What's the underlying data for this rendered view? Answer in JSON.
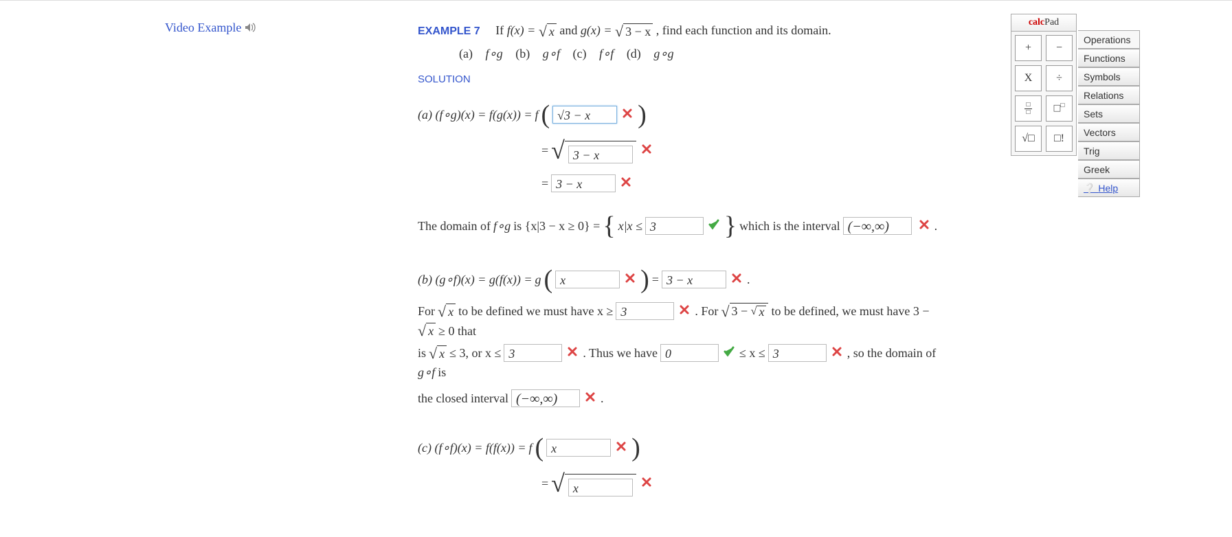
{
  "video_link": "Video Example",
  "example": {
    "label": "EXAMPLE 7",
    "prompt_a": "If ",
    "fx": "f(x) = ",
    "root_x": "x",
    "and": " and ",
    "gx": "g(x) = ",
    "root_g": "3 − x",
    "prompt_b": ", find each function and its domain."
  },
  "parts_list": {
    "a": "(a)",
    "b": "(b)",
    "c": "(c)",
    "d": "(d)",
    "fog": "f∘g",
    "gof": "g∘f",
    "fof": "f∘f",
    "gog": "g∘g"
  },
  "solution_label": "SOLUTION",
  "a": {
    "line1_pre": "(a)    (f∘g)(x) = f(g(x)) = ",
    "f": "f",
    "input1": "√3 − x",
    "eq": "=",
    "input2": "3 − x",
    "input3": "3 − x",
    "domain_pre": "The domain of ",
    "fog": "f∘g",
    "domain_mid": " is  {x|3 − x ≥ 0}  = ",
    "set_pre": "x|x ≤ ",
    "input4": "3",
    "domain_post": " which is the interval ",
    "input5": "(−∞,∞)",
    "dot": "."
  },
  "b": {
    "line1": "(b)    (g∘f)(x) = g(f(x)) = ",
    "g": "g",
    "input1": "x",
    "eq": " = ",
    "input2": "3 − x",
    "dot": ".",
    "for1": "For ",
    "rootx": "x",
    "for2": " to be defined we must have  x ≥ ",
    "input3": "3",
    "for3": " .   For ",
    "root3mx": "3 − ",
    "rootxin": "x",
    "for4": " to be defined, we must have  3 − ",
    "rootx2": "x",
    "for5": " ≥ 0  that",
    "is": "is ",
    "rootx3": "x",
    "le3": " ≤ 3,  or  x ≤ ",
    "input4": "3",
    "thus": " .   Thus we have ",
    "input5": "0",
    "lex": " ≤ x ≤ ",
    "input6": "3",
    "so": " ,   so the domain of ",
    "gof": "g∘f",
    "isword": " is",
    "closed": "the closed interval ",
    "input7": "(−∞,∞)",
    "dot2": "."
  },
  "c": {
    "line1": "(c)    (f∘f)(x) = f(f(x)) = ",
    "f": "f",
    "input1": "x",
    "eq": "=",
    "input2": "x"
  },
  "calcpad": {
    "title_a": "calc",
    "title_b": "Pad",
    "btn_plus": "+",
    "btn_minus": "−",
    "btn_x": "X",
    "btn_div": "÷",
    "btn_sqrt": "√□",
    "btn_fact": "□!"
  },
  "tabs": {
    "op": "Operations",
    "fn": "Functions",
    "sym": "Symbols",
    "rel": "Relations",
    "sets": "Sets",
    "vec": "Vectors",
    "trig": "Trig",
    "greek": "Greek",
    "help": "Help"
  }
}
